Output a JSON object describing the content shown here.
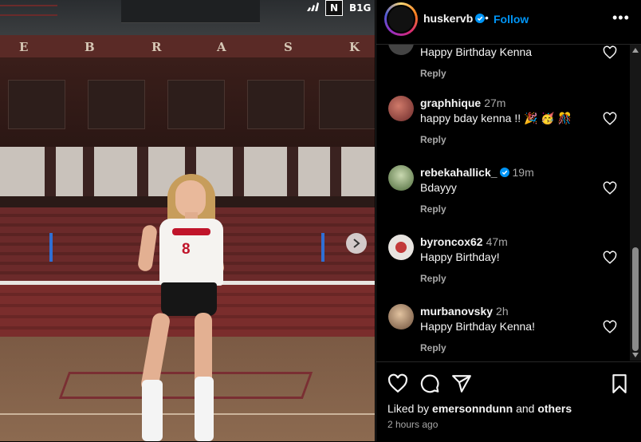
{
  "photo": {
    "banner_letters": [
      "E",
      "B",
      "R",
      "A",
      "S",
      "K"
    ],
    "jersey_number": "8",
    "logos": [
      "adidas-logo",
      "N",
      "B1G"
    ],
    "next_icon": "chevron-right-icon"
  },
  "header": {
    "username": "huskervb",
    "separator": "•",
    "follow_label": "Follow",
    "more_label": "•••"
  },
  "comments": [
    {
      "user": "",
      "time": "",
      "text": "Happy Birthday Kenna",
      "reply": "Reply",
      "avatar_color": "#444"
    },
    {
      "user": "graphhique",
      "time": "27m",
      "text": "happy bday kenna !! 🎉 🥳 🎊",
      "reply": "Reply",
      "avatar_color": "#8b3a3a"
    },
    {
      "user": "rebekahallick_",
      "verified": true,
      "time": "19m",
      "text": "Bdayyy",
      "reply": "Reply",
      "avatar_color": "#6b7d4a"
    },
    {
      "user": "byroncox62",
      "time": "47m",
      "text": "Happy Birthday!",
      "reply": "Reply",
      "avatar_color": "#b8b0aa"
    },
    {
      "user": "murbanovsky",
      "time": "2h",
      "text": "Happy Birthday Kenna!",
      "reply": "Reply",
      "avatar_color": "#a0826a"
    }
  ],
  "footer": {
    "liked_prefix": "Liked by",
    "liked_user": "emersonndunn",
    "liked_and": "and",
    "liked_others": "others",
    "time_ago": "2 hours ago"
  },
  "colors": {
    "accent": "#0095f6",
    "background": "#000000",
    "secondary_text": "#a8a8a8"
  }
}
